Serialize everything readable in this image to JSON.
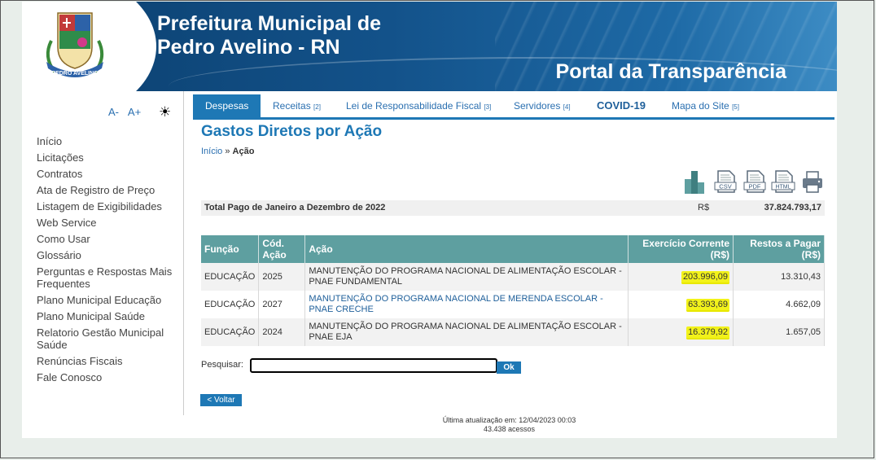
{
  "header": {
    "title_line1": "Prefeitura Municipal de",
    "title_line2": "Pedro Avelino - RN",
    "portal": "Portal da Transparência",
    "crest_text": "PEDRO AVELINO"
  },
  "sidebar": {
    "font_decrease": "A-",
    "font_increase": "A+",
    "contrast": "☀",
    "items": [
      "Início",
      "Licitações",
      "Contratos",
      "Ata de Registro de Preço",
      "Listagem de Exigibilidades",
      "Web Service",
      "Como Usar",
      "Glossário",
      "Perguntas e Respostas Mais Frequentes",
      "Plano Municipal Educação",
      "Plano Municipal Saúde",
      "Relatorio Gestão Municipal Saúde",
      "Renúncias Fiscais",
      "Fale Conosco"
    ]
  },
  "tabs": [
    {
      "label": "Despesas",
      "n": ""
    },
    {
      "label": "Receitas",
      "n": "[2]"
    },
    {
      "label": "Lei de Responsabilidade Fiscal",
      "n": "[3]"
    },
    {
      "label": "Servidores",
      "n": "[4]"
    },
    {
      "label": "COVID-19",
      "n": ""
    },
    {
      "label": "Mapa do Site",
      "n": "[5]"
    }
  ],
  "main": {
    "title": "Gastos Diretos por Ação",
    "breadcrumb": {
      "home": "Início",
      "sep": "»",
      "current": "Ação"
    },
    "export_icons": [
      "chart-icon",
      "csv-icon",
      "pdf-icon",
      "html-icon",
      "print-icon"
    ],
    "export_labels": {
      "csv": "CSV",
      "pdf": "PDF",
      "html": "HTML"
    },
    "total": {
      "label": "Total Pago de Janeiro a Dezembro de 2022",
      "currency": "R$",
      "value": "37.824.793,17"
    },
    "table": {
      "headers": {
        "funcao": "Função",
        "cod_acao": "Cód. Ação",
        "acao": "Ação",
        "exercicio": "Exercício Corrente (R$)",
        "restos": "Restos a Pagar (R$)"
      },
      "rows": [
        {
          "funcao": "EDUCAÇÃO",
          "cod": "2025",
          "acao": "MANUTENÇÃO DO PROGRAMA NACIONAL DE ALIMENTAÇÃO ESCOLAR - PNAE FUNDAMENTAL",
          "exercicio": "203.996,09",
          "restos": "13.310,43"
        },
        {
          "funcao": "EDUCAÇÃO",
          "cod": "2027",
          "acao": "MANUTENÇÃO DO PROGRAMA NACIONAL DE MERENDA ESCOLAR - PNAE CRECHE",
          "exercicio": "63.393,69",
          "restos": "4.662,09"
        },
        {
          "funcao": "EDUCAÇÃO",
          "cod": "2024",
          "acao": "MANUTENÇÃO DO PROGRAMA NACIONAL DE ALIMENTAÇÃO ESCOLAR - PNAE EJA",
          "exercicio": "16.379,92",
          "restos": "1.657,05"
        }
      ]
    },
    "search": {
      "label": "Pesquisar:",
      "value": "",
      "ok": "Ok"
    },
    "back": "< Voltar"
  },
  "footer": {
    "updated": "Última atualização em: 12/04/2023 00:03",
    "visits": "43.438 acessos"
  },
  "colors": {
    "primary": "#1e78b5",
    "table_header": "#5e9fa0",
    "highlight": "#f2f21a"
  }
}
